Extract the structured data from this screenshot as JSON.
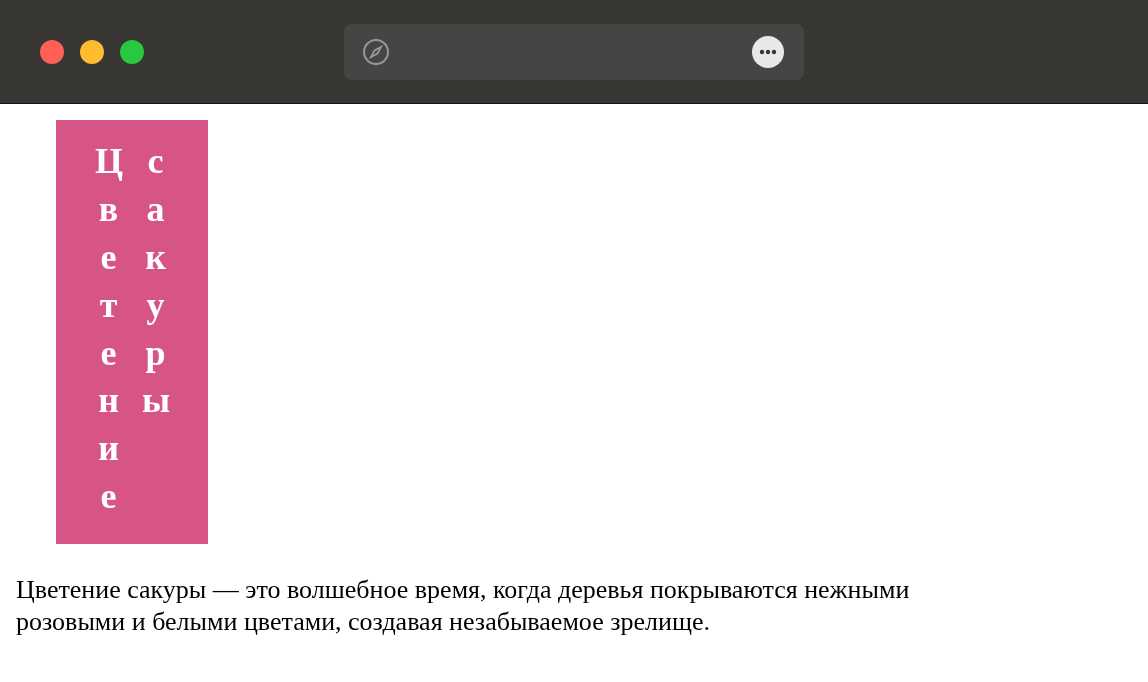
{
  "banner": {
    "columns": [
      "Цветение",
      "сакуры"
    ]
  },
  "paragraph": "Цветение сакуры — это волшебное время, когда деревья покрываются нежными розовыми и белыми цветами, создавая незабываемое зрелище."
}
